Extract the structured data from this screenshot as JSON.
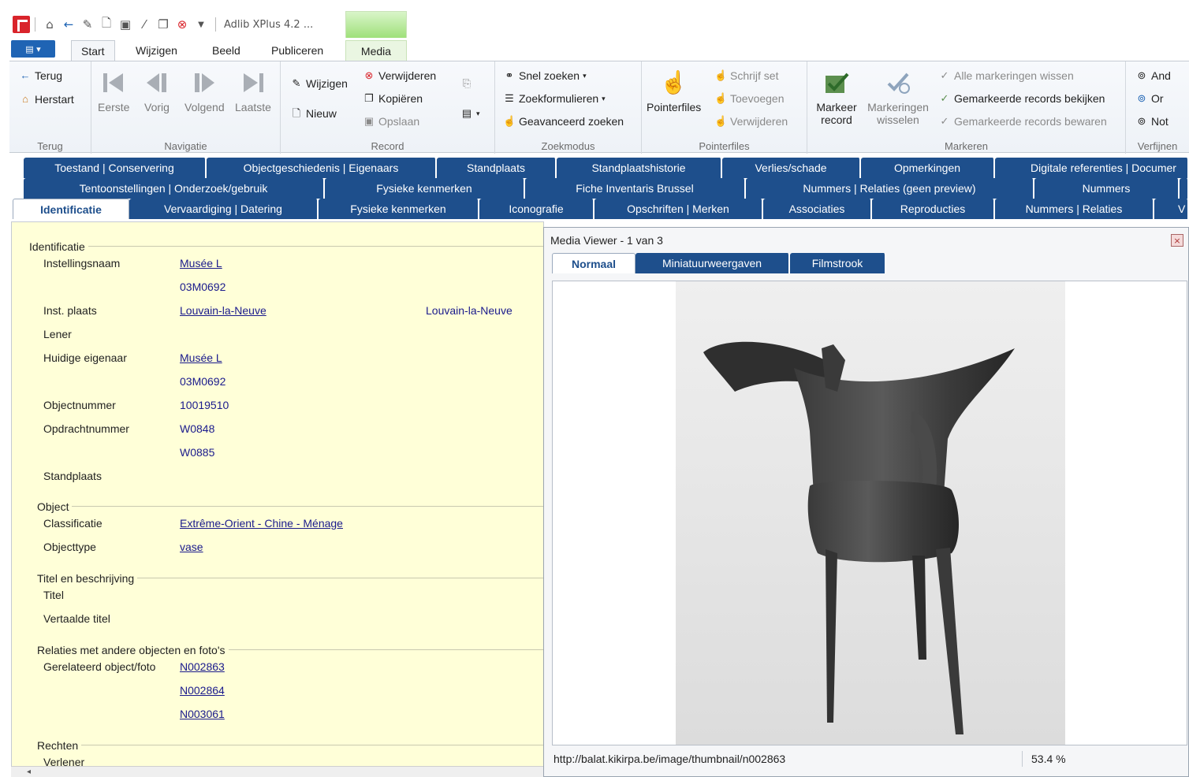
{
  "window": {
    "title": "Adlib XPlus 4.2 ..."
  },
  "ribbon_tabs": [
    "Start",
    "Wijzigen",
    "Beeld",
    "Publiceren",
    "Media"
  ],
  "ribbon": {
    "terug_group": {
      "label": "Terug",
      "back": "Terug",
      "restart": "Herstart"
    },
    "navigatie": {
      "label": "Navigatie",
      "first": "Eerste",
      "prev": "Vorig",
      "next": "Volgend",
      "last": "Laatste"
    },
    "record": {
      "label": "Record",
      "edit": "Wijzigen",
      "new": "Nieuw",
      "delete": "Verwijderen",
      "copy": "Kopiëren",
      "save": "Opslaan"
    },
    "zoekmodus": {
      "label": "Zoekmodus",
      "quick": "Snel zoeken",
      "forms": "Zoekformulieren",
      "advanced": "Geavanceerd zoeken"
    },
    "pointerfiles": {
      "label": "Pointerfiles",
      "main": "Pointerfiles",
      "write_set": "Schrijf set",
      "add": "Toevoegen",
      "remove": "Verwijderen"
    },
    "markeren": {
      "label": "Markeren",
      "mark_record": "Markeer record",
      "switch_marks": "Markeringen wisselen",
      "clear_all": "Alle markeringen wissen",
      "view_marked": "Gemarkeerde records bekijken",
      "save_marked": "Gemarkeerde records bewaren"
    },
    "verfijnen": {
      "label": "Verfijnen",
      "and": "And",
      "or": "Or",
      "not": "Not"
    }
  },
  "record_tabs": {
    "row1": [
      "Toestand | Conservering",
      "Objectgeschiedenis | Eigenaars",
      "Standplaats",
      "Standplaatshistorie",
      "Verlies/schade",
      "Opmerkingen",
      "Digitale referenties | Documer"
    ],
    "row2": [
      "Tentoonstellingen | Onderzoek/gebruik",
      "Fysieke kenmerken",
      "Fiche Inventaris Brussel",
      "Nummers | Relaties (geen preview)",
      "Nummers"
    ],
    "row3": [
      "Identificatie",
      "Vervaardiging | Datering",
      "Fysieke kenmerken",
      "Iconografie",
      "Opschriften | Merken",
      "Associaties",
      "Reproducties",
      "Nummers | Relaties",
      "V"
    ]
  },
  "form": {
    "sections": {
      "identificatie": "Identificatie",
      "object": "Object",
      "titel": "Titel en beschrijving",
      "relaties": "Relaties met andere objecten en foto's",
      "rechten": "Rechten"
    },
    "labels": {
      "instellingsnaam": "Instellingsnaam",
      "inst_plaats": "Inst. plaats",
      "lener": "Lener",
      "huidige_eigenaar": "Huidige eigenaar",
      "objectnummer": "Objectnummer",
      "opdrachtnummer": "Opdrachtnummer",
      "standplaats": "Standplaats",
      "classificatie": "Classificatie",
      "objecttype": "Objecttype",
      "titel": "Titel",
      "vertaalde_titel": "Vertaalde titel",
      "gerelateerd": "Gerelateerd object/foto",
      "verlener": "Verlener"
    },
    "values": {
      "instellingsnaam": "Musée L",
      "instellingscode": "03M0692",
      "inst_plaats": "Louvain-la-Neuve",
      "inst_plaats_2": "Louvain-la-Neuve",
      "eigenaar": "Musée L",
      "eigenaar_code": "03M0692",
      "objectnummer": "10019510",
      "opdracht_1": "W0848",
      "opdracht_2": "W0885",
      "classificatie": "Extrême-Orient - Chine - Ménage",
      "objecttype": "vase",
      "rel_1": "N002863",
      "rel_2": "N002864",
      "rel_3": "N003061"
    }
  },
  "media_viewer": {
    "title": "Media Viewer - 1 van 3",
    "tabs": [
      "Normaal",
      "Miniatuurweergaven",
      "Filmstrook"
    ],
    "url": "http://balat.kikirpa.be/image/thumbnail/n002863",
    "zoom": "53.4 %"
  },
  "colors": {
    "tab_blue": "#1e4f8c",
    "form_bg": "#ffffd8",
    "link": "#1a1a8c",
    "media_tab_green": "#9fe07a"
  }
}
